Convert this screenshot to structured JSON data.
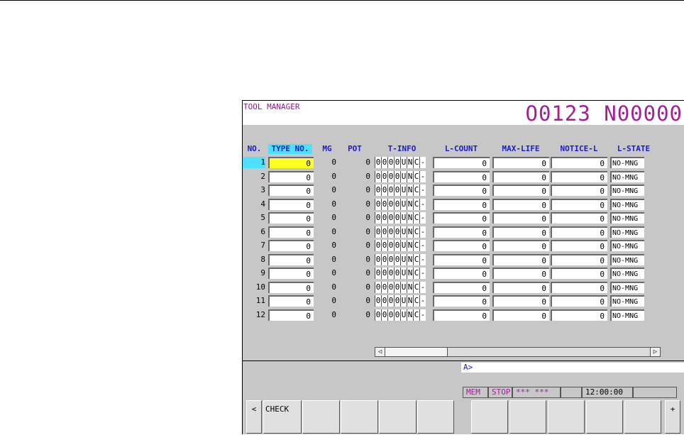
{
  "screen": {
    "title": "TOOL MANAGER",
    "program_number": "O0123 N00000",
    "columns": [
      "NO.",
      "TYPE NO.",
      "MG",
      "POT",
      "T-INFO",
      "L-COUNT",
      "MAX-LIFE",
      "NOTICE-L",
      "L-STATE"
    ],
    "rows": [
      {
        "no": "1",
        "type_no": "0",
        "mg": "0",
        "pot": "0",
        "tinfo": [
          "0",
          "0",
          "0",
          "0",
          "U",
          "N",
          "C",
          "-"
        ],
        "l_count": "0",
        "max_life": "0",
        "notice_l": "0",
        "l_state": "NO-MNG"
      },
      {
        "no": "2",
        "type_no": "0",
        "mg": "0",
        "pot": "0",
        "tinfo": [
          "0",
          "0",
          "0",
          "0",
          "U",
          "N",
          "C",
          "-"
        ],
        "l_count": "0",
        "max_life": "0",
        "notice_l": "0",
        "l_state": "NO-MNG"
      },
      {
        "no": "3",
        "type_no": "0",
        "mg": "0",
        "pot": "0",
        "tinfo": [
          "0",
          "0",
          "0",
          "0",
          "U",
          "N",
          "C",
          "-"
        ],
        "l_count": "0",
        "max_life": "0",
        "notice_l": "0",
        "l_state": "NO-MNG"
      },
      {
        "no": "4",
        "type_no": "0",
        "mg": "0",
        "pot": "0",
        "tinfo": [
          "0",
          "0",
          "0",
          "0",
          "U",
          "N",
          "C",
          "-"
        ],
        "l_count": "0",
        "max_life": "0",
        "notice_l": "0",
        "l_state": "NO-MNG"
      },
      {
        "no": "5",
        "type_no": "0",
        "mg": "0",
        "pot": "0",
        "tinfo": [
          "0",
          "0",
          "0",
          "0",
          "U",
          "N",
          "C",
          "-"
        ],
        "l_count": "0",
        "max_life": "0",
        "notice_l": "0",
        "l_state": "NO-MNG"
      },
      {
        "no": "6",
        "type_no": "0",
        "mg": "0",
        "pot": "0",
        "tinfo": [
          "0",
          "0",
          "0",
          "0",
          "U",
          "N",
          "C",
          "-"
        ],
        "l_count": "0",
        "max_life": "0",
        "notice_l": "0",
        "l_state": "NO-MNG"
      },
      {
        "no": "7",
        "type_no": "0",
        "mg": "0",
        "pot": "0",
        "tinfo": [
          "0",
          "0",
          "0",
          "0",
          "U",
          "N",
          "C",
          "-"
        ],
        "l_count": "0",
        "max_life": "0",
        "notice_l": "0",
        "l_state": "NO-MNG"
      },
      {
        "no": "8",
        "type_no": "0",
        "mg": "0",
        "pot": "0",
        "tinfo": [
          "0",
          "0",
          "0",
          "0",
          "U",
          "N",
          "C",
          "-"
        ],
        "l_count": "0",
        "max_life": "0",
        "notice_l": "0",
        "l_state": "NO-MNG"
      },
      {
        "no": "9",
        "type_no": "0",
        "mg": "0",
        "pot": "0",
        "tinfo": [
          "0",
          "0",
          "0",
          "0",
          "U",
          "N",
          "C",
          "-"
        ],
        "l_count": "0",
        "max_life": "0",
        "notice_l": "0",
        "l_state": "NO-MNG"
      },
      {
        "no": "10",
        "type_no": "0",
        "mg": "0",
        "pot": "0",
        "tinfo": [
          "0",
          "0",
          "0",
          "0",
          "U",
          "N",
          "C",
          "-"
        ],
        "l_count": "0",
        "max_life": "0",
        "notice_l": "0",
        "l_state": "NO-MNG"
      },
      {
        "no": "11",
        "type_no": "0",
        "mg": "0",
        "pot": "0",
        "tinfo": [
          "0",
          "0",
          "0",
          "0",
          "U",
          "N",
          "C",
          "-"
        ],
        "l_count": "0",
        "max_life": "0",
        "notice_l": "0",
        "l_state": "NO-MNG"
      },
      {
        "no": "12",
        "type_no": "0",
        "mg": "0",
        "pot": "0",
        "tinfo": [
          "0",
          "0",
          "0",
          "0",
          "U",
          "N",
          "C",
          "-"
        ],
        "l_count": "0",
        "max_life": "0",
        "notice_l": "0",
        "l_state": "NO-MNG"
      }
    ],
    "scroll": {
      "left_arrow": "◁",
      "right_arrow": "▷"
    },
    "input_prompt": "A>",
    "status": {
      "mode": "MEM",
      "state": "STOP",
      "alarm": "*** ***",
      "blank": "",
      "time": "12:00:00",
      "blank2": ""
    },
    "softkeys": {
      "prev": "<",
      "keys": [
        "CHECK",
        "",
        "",
        "",
        "",
        "",
        "",
        "",
        "",
        "",
        ""
      ],
      "next": "+"
    }
  },
  "colors": {
    "background": "#c7c7c7",
    "title": "#a0209a",
    "header": "#1c1cc8",
    "selected_cell": "#ffff22",
    "selected_header": "#4fe0ff"
  }
}
